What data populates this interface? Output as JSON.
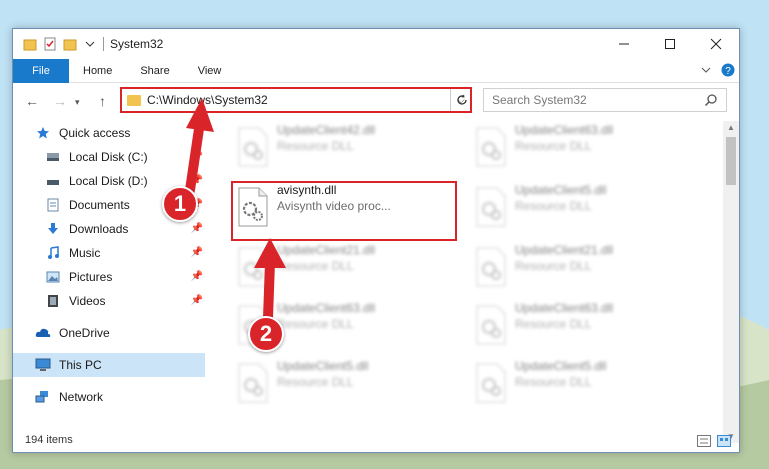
{
  "window": {
    "title": "System32"
  },
  "ribbon": {
    "tabs": [
      "File",
      "Home",
      "Share",
      "View"
    ]
  },
  "address": {
    "path": "C:\\Windows\\System32"
  },
  "search": {
    "placeholder": "Search System32"
  },
  "sidebar": {
    "items": [
      {
        "label": "Quick access",
        "icon": "star-icon"
      },
      {
        "label": "Local Disk (C:)",
        "icon": "drive-icon",
        "pinned": true
      },
      {
        "label": "Local Disk (D:)",
        "icon": "drive-icon",
        "pinned": true
      },
      {
        "label": "Documents",
        "icon": "documents-icon",
        "pinned": true
      },
      {
        "label": "Downloads",
        "icon": "download-icon",
        "pinned": true
      },
      {
        "label": "Music",
        "icon": "music-icon",
        "pinned": true
      },
      {
        "label": "Pictures",
        "icon": "pictures-icon",
        "pinned": true
      },
      {
        "label": "Videos",
        "icon": "videos-icon",
        "pinned": true
      },
      {
        "label": "OneDrive",
        "icon": "cloud-icon"
      },
      {
        "label": "This PC",
        "icon": "computer-icon",
        "selected": true
      },
      {
        "label": "Network",
        "icon": "network-icon"
      }
    ]
  },
  "files": {
    "highlighted": {
      "name": "avisynth.dll",
      "desc": "Avisynth video proc..."
    },
    "left_column": [
      {
        "name": "UpdateClient42.dll",
        "desc": "Resource DLL"
      },
      {
        "name": "UpdateClient21.dll",
        "desc": "Resource DLL"
      },
      {
        "name": "UpdateClient63.dll",
        "desc": "Resource DLL"
      },
      {
        "name": "UpdateClient5.dll",
        "desc": "Resource DLL"
      }
    ],
    "right_column": [
      {
        "name": "UpdateClient63.dll",
        "desc": "Resource DLL"
      },
      {
        "name": "UpdateClient5.dll",
        "desc": "Resource DLL"
      },
      {
        "name": "UpdateClient21.dll",
        "desc": "Resource DLL"
      },
      {
        "name": "UpdateClient63.dll",
        "desc": "Resource DLL"
      },
      {
        "name": "UpdateClient5.dll",
        "desc": "Resource DLL"
      }
    ]
  },
  "status": {
    "count": "194 items"
  },
  "annotations": {
    "step1": "1",
    "step2": "2"
  },
  "colors": {
    "accent": "#1979ca",
    "highlight": "#d9252a",
    "selected": "#cce4f7"
  }
}
